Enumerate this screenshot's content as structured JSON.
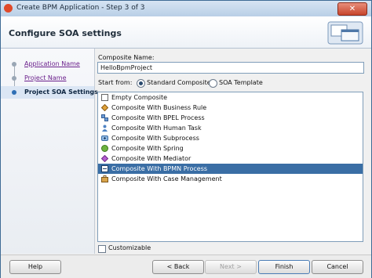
{
  "window": {
    "title": "Create BPM Application - Step 3 of 3",
    "close_glyph": "✕"
  },
  "header": {
    "title": "Configure SOA settings"
  },
  "nav": {
    "items": [
      {
        "label": "Application Name"
      },
      {
        "label": "Project Name"
      },
      {
        "label": "Project SOA Settings"
      }
    ]
  },
  "form": {
    "composite_name_label": "Composite Name:",
    "composite_name_value": "HelloBpmProject",
    "start_from_label": "Start from:",
    "radio_standard": "Standard Composite",
    "radio_template": "SOA Template",
    "selected_radio": "Standard Composite",
    "templates": [
      {
        "label": "Empty Composite",
        "icon": "empty-composite-icon"
      },
      {
        "label": "Composite With Business Rule",
        "icon": "business-rule-icon"
      },
      {
        "label": "Composite With BPEL Process",
        "icon": "bpel-process-icon"
      },
      {
        "label": "Composite With Human Task",
        "icon": "human-task-icon"
      },
      {
        "label": "Composite With Subprocess",
        "icon": "subprocess-icon"
      },
      {
        "label": "Composite With Spring",
        "icon": "spring-icon"
      },
      {
        "label": "Composite With Mediator",
        "icon": "mediator-icon"
      },
      {
        "label": "Composite With BPMN Process",
        "icon": "bpmn-process-icon"
      },
      {
        "label": "Composite With Case Management",
        "icon": "case-management-icon"
      }
    ],
    "selected_template": "Composite With BPMN Process",
    "customizable_label": "Customizable"
  },
  "footer": {
    "help": "Help",
    "back": "< Back",
    "next": "Next >",
    "finish": "Finish",
    "cancel": "Cancel"
  },
  "colors": {
    "selection": "#3a6ea5",
    "link": "#6a1f8b",
    "title_bar": "#c7d9ec"
  }
}
